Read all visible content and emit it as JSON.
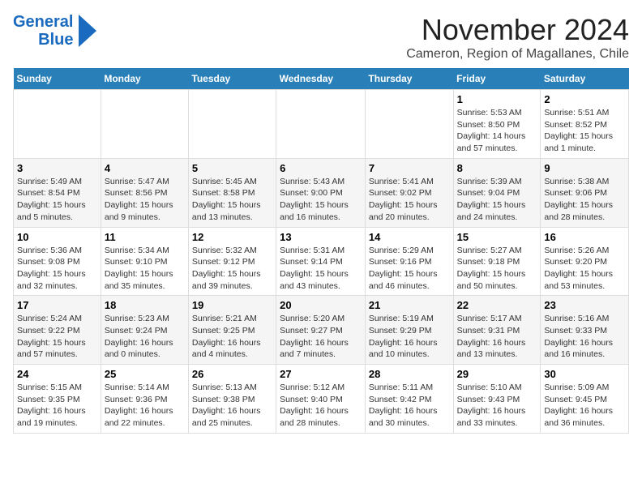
{
  "header": {
    "logo_line1": "General",
    "logo_line2": "Blue",
    "month_title": "November 2024",
    "location": "Cameron, Region of Magallanes, Chile"
  },
  "weekdays": [
    "Sunday",
    "Monday",
    "Tuesday",
    "Wednesday",
    "Thursday",
    "Friday",
    "Saturday"
  ],
  "weeks": [
    [
      {
        "day": "",
        "info": ""
      },
      {
        "day": "",
        "info": ""
      },
      {
        "day": "",
        "info": ""
      },
      {
        "day": "",
        "info": ""
      },
      {
        "day": "",
        "info": ""
      },
      {
        "day": "1",
        "info": "Sunrise: 5:53 AM\nSunset: 8:50 PM\nDaylight: 14 hours and 57 minutes."
      },
      {
        "day": "2",
        "info": "Sunrise: 5:51 AM\nSunset: 8:52 PM\nDaylight: 15 hours and 1 minute."
      }
    ],
    [
      {
        "day": "3",
        "info": "Sunrise: 5:49 AM\nSunset: 8:54 PM\nDaylight: 15 hours and 5 minutes."
      },
      {
        "day": "4",
        "info": "Sunrise: 5:47 AM\nSunset: 8:56 PM\nDaylight: 15 hours and 9 minutes."
      },
      {
        "day": "5",
        "info": "Sunrise: 5:45 AM\nSunset: 8:58 PM\nDaylight: 15 hours and 13 minutes."
      },
      {
        "day": "6",
        "info": "Sunrise: 5:43 AM\nSunset: 9:00 PM\nDaylight: 15 hours and 16 minutes."
      },
      {
        "day": "7",
        "info": "Sunrise: 5:41 AM\nSunset: 9:02 PM\nDaylight: 15 hours and 20 minutes."
      },
      {
        "day": "8",
        "info": "Sunrise: 5:39 AM\nSunset: 9:04 PM\nDaylight: 15 hours and 24 minutes."
      },
      {
        "day": "9",
        "info": "Sunrise: 5:38 AM\nSunset: 9:06 PM\nDaylight: 15 hours and 28 minutes."
      }
    ],
    [
      {
        "day": "10",
        "info": "Sunrise: 5:36 AM\nSunset: 9:08 PM\nDaylight: 15 hours and 32 minutes."
      },
      {
        "day": "11",
        "info": "Sunrise: 5:34 AM\nSunset: 9:10 PM\nDaylight: 15 hours and 35 minutes."
      },
      {
        "day": "12",
        "info": "Sunrise: 5:32 AM\nSunset: 9:12 PM\nDaylight: 15 hours and 39 minutes."
      },
      {
        "day": "13",
        "info": "Sunrise: 5:31 AM\nSunset: 9:14 PM\nDaylight: 15 hours and 43 minutes."
      },
      {
        "day": "14",
        "info": "Sunrise: 5:29 AM\nSunset: 9:16 PM\nDaylight: 15 hours and 46 minutes."
      },
      {
        "day": "15",
        "info": "Sunrise: 5:27 AM\nSunset: 9:18 PM\nDaylight: 15 hours and 50 minutes."
      },
      {
        "day": "16",
        "info": "Sunrise: 5:26 AM\nSunset: 9:20 PM\nDaylight: 15 hours and 53 minutes."
      }
    ],
    [
      {
        "day": "17",
        "info": "Sunrise: 5:24 AM\nSunset: 9:22 PM\nDaylight: 15 hours and 57 minutes."
      },
      {
        "day": "18",
        "info": "Sunrise: 5:23 AM\nSunset: 9:24 PM\nDaylight: 16 hours and 0 minutes."
      },
      {
        "day": "19",
        "info": "Sunrise: 5:21 AM\nSunset: 9:25 PM\nDaylight: 16 hours and 4 minutes."
      },
      {
        "day": "20",
        "info": "Sunrise: 5:20 AM\nSunset: 9:27 PM\nDaylight: 16 hours and 7 minutes."
      },
      {
        "day": "21",
        "info": "Sunrise: 5:19 AM\nSunset: 9:29 PM\nDaylight: 16 hours and 10 minutes."
      },
      {
        "day": "22",
        "info": "Sunrise: 5:17 AM\nSunset: 9:31 PM\nDaylight: 16 hours and 13 minutes."
      },
      {
        "day": "23",
        "info": "Sunrise: 5:16 AM\nSunset: 9:33 PM\nDaylight: 16 hours and 16 minutes."
      }
    ],
    [
      {
        "day": "24",
        "info": "Sunrise: 5:15 AM\nSunset: 9:35 PM\nDaylight: 16 hours and 19 minutes."
      },
      {
        "day": "25",
        "info": "Sunrise: 5:14 AM\nSunset: 9:36 PM\nDaylight: 16 hours and 22 minutes."
      },
      {
        "day": "26",
        "info": "Sunrise: 5:13 AM\nSunset: 9:38 PM\nDaylight: 16 hours and 25 minutes."
      },
      {
        "day": "27",
        "info": "Sunrise: 5:12 AM\nSunset: 9:40 PM\nDaylight: 16 hours and 28 minutes."
      },
      {
        "day": "28",
        "info": "Sunrise: 5:11 AM\nSunset: 9:42 PM\nDaylight: 16 hours and 30 minutes."
      },
      {
        "day": "29",
        "info": "Sunrise: 5:10 AM\nSunset: 9:43 PM\nDaylight: 16 hours and 33 minutes."
      },
      {
        "day": "30",
        "info": "Sunrise: 5:09 AM\nSunset: 9:45 PM\nDaylight: 16 hours and 36 minutes."
      }
    ]
  ]
}
